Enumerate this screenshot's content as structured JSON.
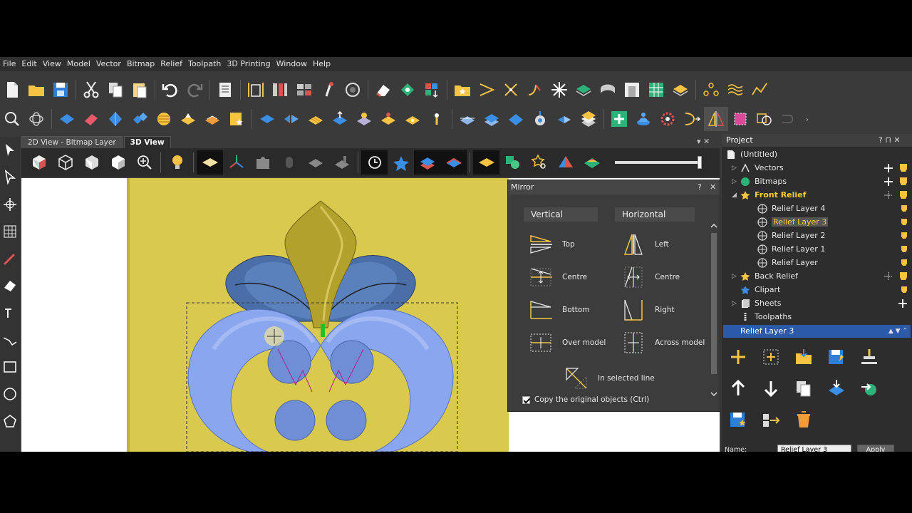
{
  "menu": [
    "File",
    "Edit",
    "View",
    "Model",
    "Vector",
    "Bitmap",
    "Relief",
    "Toolpath",
    "3D Printing",
    "Window",
    "Help"
  ],
  "tabs": {
    "bitmap": "2D View - Bitmap Layer",
    "view3d": "3D View",
    "close": "▾  ✕"
  },
  "mirror": {
    "title": "Mirror",
    "help": "?",
    "close": "✕",
    "vertical": "Vertical",
    "horizontal": "Horizontal",
    "top": "Top",
    "centre_v": "Centre",
    "bottom": "Bottom",
    "over_model": "Over model",
    "left": "Left",
    "centre_h": "Centre",
    "right": "Right",
    "across_model": "Across model",
    "in_selected_line": "In selected line",
    "copy_original": "Copy the original objects (Ctrl)"
  },
  "project": {
    "title": "Project",
    "controls": "?  ⊓  ✕",
    "root": "(Untitled)",
    "vectors": "Vectors",
    "bitmaps": "Bitmaps",
    "front_relief": "Front Relief",
    "layer4": "Relief Layer 4",
    "layer3": "Relief Layer 3",
    "layer2": "Relief Layer 2",
    "layer1": "Relief Layer 1",
    "layer0": "Relief Layer",
    "back_relief": "Back Relief",
    "clipart": "Clipart",
    "sheets": "Sheets",
    "toolpaths": "Toolpaths"
  },
  "layer_panel": {
    "title": "Relief Layer 3",
    "name_label": "Name:",
    "name_value": "Relief Layer 3",
    "apply": "Apply"
  },
  "colors": {
    "accent_yellow": "#ffcc33",
    "relief_blue": "#7f9ee8",
    "model_gold": "#d9c94f",
    "selection_blue": "#2a5aa8"
  }
}
